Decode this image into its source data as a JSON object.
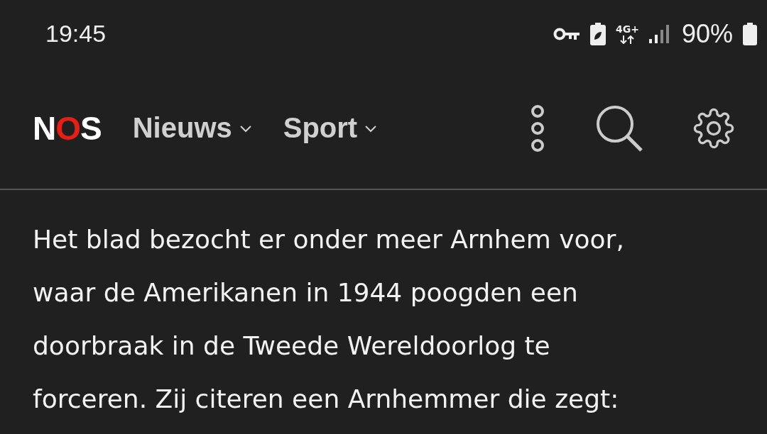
{
  "status_bar": {
    "time": "19:45",
    "network": "4G+",
    "battery": "90%"
  },
  "header": {
    "logo": "NOS",
    "menus": [
      {
        "label": "Nieuws"
      },
      {
        "label": "Sport"
      }
    ]
  },
  "article": {
    "paragraph_lines": [
      "Het blad bezocht er onder meer Arnhem voor,",
      "waar de Amerikanen in 1944 poogden een",
      "doorbraak in de Tweede Wereldoorlog te",
      "forceren. Zij citeren een Arnhemmer die zegt:"
    ]
  }
}
